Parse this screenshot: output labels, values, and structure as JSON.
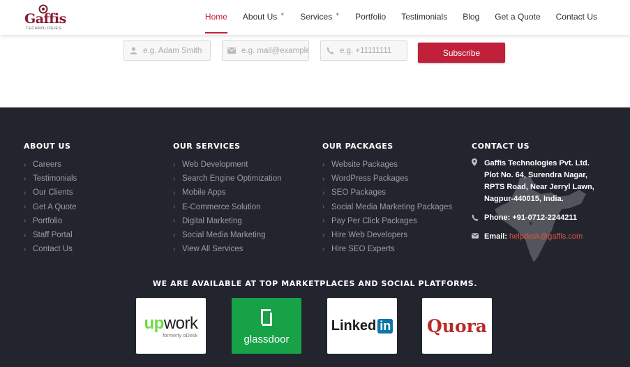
{
  "brand": {
    "name": "Gaffis",
    "tagline": "TECHNOLOGIES",
    "accent": "#c0203a",
    "footer_bg": "#23252e"
  },
  "nav": {
    "items": [
      {
        "label": "Home",
        "active": true,
        "has_caret": false
      },
      {
        "label": "About Us",
        "active": false,
        "has_caret": true
      },
      {
        "label": "Services",
        "active": false,
        "has_caret": true
      },
      {
        "label": "Portfolio",
        "active": false,
        "has_caret": false
      },
      {
        "label": "Testimonials",
        "active": false,
        "has_caret": false
      },
      {
        "label": "Blog",
        "active": false,
        "has_caret": false
      },
      {
        "label": "Get a Quote",
        "active": false,
        "has_caret": false
      },
      {
        "label": "Contact Us",
        "active": false,
        "has_caret": false
      }
    ]
  },
  "subscribe": {
    "name_placeholder": "e.g. Adam Smith",
    "email_placeholder": "e.g. mail@example.com",
    "phone_placeholder": "e.g. +11111111",
    "button_label": "Subscribe",
    "icons": [
      "user-icon",
      "envelope-icon",
      "phone-icon"
    ]
  },
  "footer": {
    "about": {
      "title": "ABOUT US",
      "links": [
        "Careers",
        "Testimonials",
        "Our Clients",
        "Get A Quote",
        "Portfolio",
        "Staff Portal",
        "Contact Us"
      ]
    },
    "services": {
      "title": "OUR SERVICES",
      "links": [
        "Web Development",
        "Search Engine Optimization",
        "Mobile Apps",
        "E-Commerce Solution",
        "Digital Marketing",
        "Social Media Marketing",
        "View All Services"
      ]
    },
    "packages": {
      "title": "OUR PACKAGES",
      "links": [
        "Website Packages",
        "WordPress Packages",
        "SEO Packages",
        "Social Media Marketing Packages",
        "Pay Per Click Packages",
        "Hire Web Developers",
        "Hire SEO Experts"
      ]
    },
    "contact": {
      "title": "CONTACT US",
      "address_lines": [
        "Gaffis Technologies Pvt. Ltd.",
        "Plot No. 64, Surendra Nagar,",
        "RPTS Road, Near Jerryl Lawn,",
        "Nagpur-440015, India."
      ],
      "phone": "Phone: +91-0712-2244211",
      "email_label": "Email:",
      "email": "helpdesk@gaffis.com"
    },
    "marketplaces": {
      "title": "WE ARE AVAILABLE AT TOP MARKETPLACES AND SOCIAL PLATFORMS.",
      "upwork": {
        "word_a": "up",
        "word_b": "work",
        "sub": "formerly oDesk"
      },
      "glassdoor": {
        "word": "glassdoor"
      },
      "linkedin": {
        "word_a": "Linked",
        "word_b": "in"
      },
      "quora": {
        "word": "Quora"
      }
    }
  }
}
